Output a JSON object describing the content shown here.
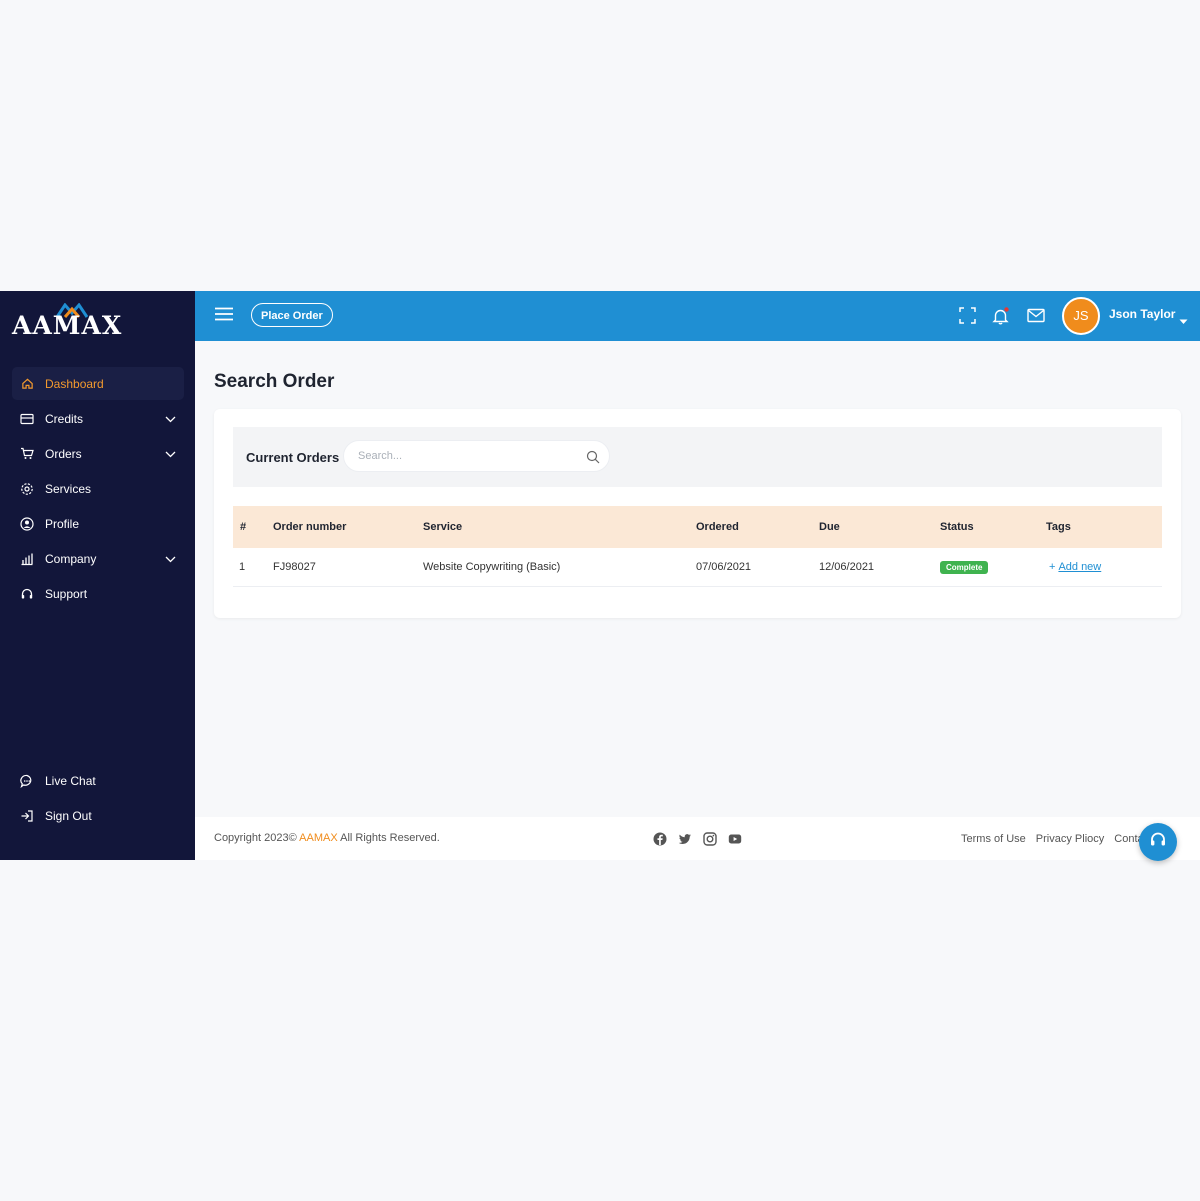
{
  "brand": {
    "name": "AAMAX",
    "accent": "#f08c1c",
    "sidebar_bg": "#12163a",
    "topbar_bg": "#1f8fd3"
  },
  "sidebar": {
    "items": [
      {
        "label": "Dashboard",
        "icon": "home-icon",
        "active": true
      },
      {
        "label": "Credits",
        "icon": "card-icon",
        "expandable": true
      },
      {
        "label": "Orders",
        "icon": "cart-icon",
        "expandable": true
      },
      {
        "label": "Services",
        "icon": "gear-icon"
      },
      {
        "label": "Profile",
        "icon": "user-circle-icon"
      },
      {
        "label": "Company",
        "icon": "chart-icon",
        "expandable": true
      },
      {
        "label": "Support",
        "icon": "headset-icon"
      }
    ],
    "bottom_items": [
      {
        "label": "Live Chat",
        "icon": "chat-icon"
      },
      {
        "label": "Sign Out",
        "icon": "sign-out-icon"
      }
    ]
  },
  "topbar": {
    "place_order": "Place Order",
    "user_initials": "JS",
    "user_name": "Json Taylor",
    "icons": [
      "menu-icon",
      "fullscreen-icon",
      "bell-icon",
      "mail-icon",
      "chevron-down-icon"
    ]
  },
  "main": {
    "title": "Search Order",
    "card": {
      "label": "Current Orders",
      "search_placeholder": "Search...",
      "columns": [
        "#",
        "Order number",
        "Service",
        "Ordered",
        "Due",
        "Status",
        "Tags"
      ],
      "rows": [
        {
          "num": "1",
          "order_number": "FJ98027",
          "service": "Website Copywriting (Basic)",
          "ordered": "07/06/2021",
          "due": "12/06/2021",
          "status": "Complete",
          "tag_plus": "+",
          "tag_action": "Add new"
        }
      ]
    }
  },
  "footer": {
    "copyright_prefix": "Copyright 2023©",
    "copyright_brand": "AAMAX",
    "copyright_suffix": "All Rights Reserved.",
    "links": [
      "Terms of Use",
      "Privacy Pliocy",
      "Contacts"
    ],
    "socials": [
      "facebook-icon",
      "twitter-icon",
      "instagram-icon",
      "youtube-icon"
    ]
  }
}
